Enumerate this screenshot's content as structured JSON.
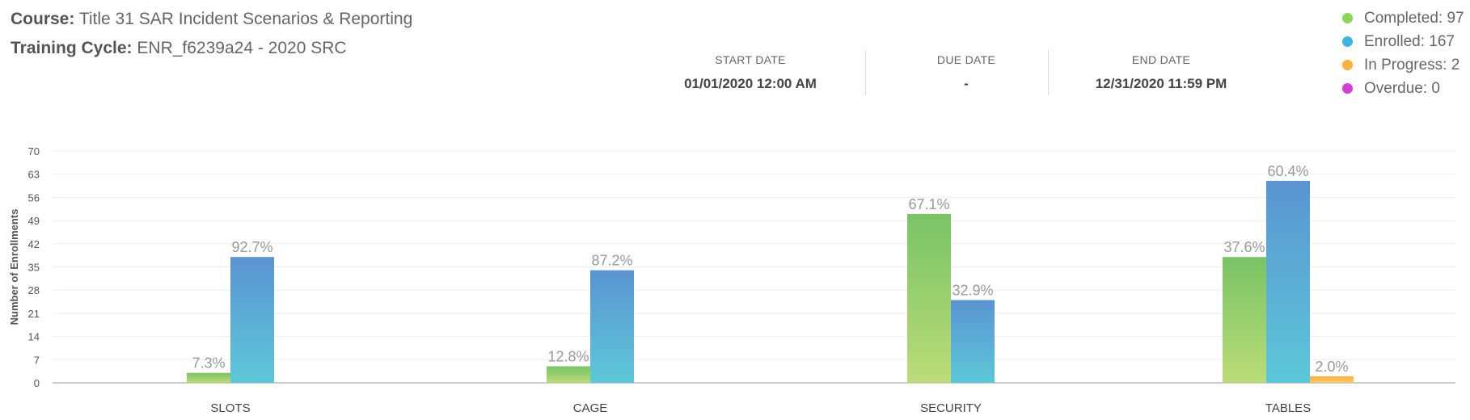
{
  "course": {
    "label": "Course:",
    "value": "Title 31 SAR Incident Scenarios & Reporting"
  },
  "training_cycle": {
    "label": "Training Cycle:",
    "value": "ENR_f6239a24 - 2020 SRC"
  },
  "dates": {
    "start": {
      "label": "START DATE",
      "value": "01/01/2020 12:00 AM"
    },
    "due": {
      "label": "DUE DATE",
      "value": "-"
    },
    "end": {
      "label": "END DATE",
      "value": "12/31/2020 11:59 PM"
    }
  },
  "legend": [
    {
      "text": "Completed: 97",
      "color": "#8cd65a"
    },
    {
      "text": "Enrolled: 167",
      "color": "#3cb4e6"
    },
    {
      "text": "In Progress: 2",
      "color": "#ffb13b"
    },
    {
      "text": "Overdue: 0",
      "color": "#d63ed6"
    }
  ],
  "chart_data": {
    "type": "bar",
    "categories": [
      "SLOTS",
      "CAGE",
      "SECURITY",
      "TABLES"
    ],
    "series": [
      {
        "name": "Completed",
        "values": [
          3,
          5,
          51,
          38
        ],
        "labels": [
          "7.3%",
          "12.8%",
          "67.1%",
          "37.6%"
        ],
        "color_top": "#78c466",
        "color_bottom": "#bcdc78"
      },
      {
        "name": "Enrolled",
        "values": [
          38,
          34,
          25,
          61
        ],
        "labels": [
          "92.7%",
          "87.2%",
          "32.9%",
          "60.4%"
        ],
        "color_top": "#5a94d2",
        "color_bottom": "#5cc8d8"
      },
      {
        "name": "In Progress",
        "values": [
          0,
          0,
          0,
          2
        ],
        "labels": [
          "",
          "",
          "",
          "2.0%"
        ],
        "color_top": "#ffb13b",
        "color_bottom": "#ffc867"
      }
    ],
    "ylabel": "Number of Enrollments",
    "xlabel": "",
    "ylim": [
      0,
      70
    ],
    "yticks": [
      0,
      7,
      14,
      21,
      28,
      35,
      42,
      49,
      56,
      63,
      70
    ],
    "grid": true
  }
}
